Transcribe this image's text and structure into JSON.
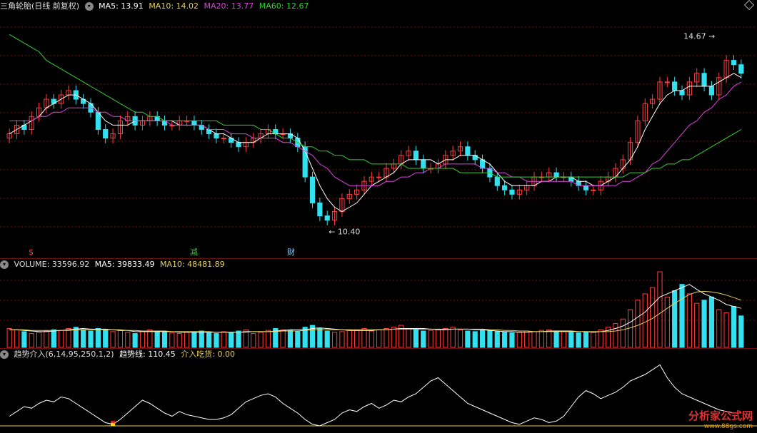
{
  "main_header": {
    "title": "三角轮胎(日线 前复权)",
    "ma5": "MA5: 13.91",
    "ma10": "MA10: 14.02",
    "ma20": "MA20: 13.77",
    "ma60": "MA60: 12.67"
  },
  "annotations": {
    "high_label": "14.67",
    "low_label": "10.40",
    "mark_s": "$",
    "mark_jian": "减",
    "mark_cai": "财"
  },
  "volume_header": {
    "volume": "VOLUME: 33596.92",
    "ma5": "MA5: 39833.49",
    "ma10": "MA10: 48481.89"
  },
  "indicator_header": {
    "name": "趋势介入(6,14,95,250,1,2)",
    "trend": "趋势线: 110.45",
    "entry": "介入吃货: 0.00"
  },
  "watermark": {
    "text": "分析家公式网",
    "url": "www.88gs.com"
  },
  "colors": {
    "up": "#ff3d3d",
    "down": "#33e0f0",
    "ma5": "#ffffff",
    "ma10": "#e6d060",
    "ma20": "#e040e0",
    "ma60": "#30d030",
    "grid": "#7a1010"
  },
  "chart_data": [
    {
      "type": "candlestick",
      "title": "三角轮胎(日线 前复权)",
      "ylim": [
        10.0,
        15.4
      ],
      "annotations": [
        {
          "label": "14.67",
          "kind": "high"
        },
        {
          "label": "10.40",
          "kind": "low"
        }
      ],
      "close": [
        12.6,
        12.8,
        12.7,
        13.0,
        13.2,
        13.4,
        13.3,
        13.5,
        13.6,
        13.4,
        13.3,
        13.1,
        12.7,
        12.5,
        12.6,
        12.9,
        13.0,
        12.8,
        12.9,
        13.0,
        12.9,
        12.8,
        12.8,
        12.9,
        12.9,
        12.8,
        12.7,
        12.6,
        12.5,
        12.5,
        12.4,
        12.3,
        12.4,
        12.5,
        12.6,
        12.7,
        12.6,
        12.6,
        12.5,
        12.3,
        11.6,
        11.0,
        10.7,
        10.6,
        10.8,
        11.1,
        11.2,
        11.3,
        11.5,
        11.6,
        11.6,
        11.8,
        11.9,
        12.1,
        12.2,
        12.0,
        11.8,
        11.8,
        11.9,
        12.1,
        12.2,
        12.3,
        12.1,
        12.0,
        11.8,
        11.6,
        11.4,
        11.3,
        11.2,
        11.3,
        11.4,
        11.6,
        11.6,
        11.7,
        11.6,
        11.6,
        11.5,
        11.4,
        11.3,
        11.3,
        11.5,
        11.6,
        11.8,
        12.0,
        12.4,
        12.9,
        13.3,
        13.4,
        13.8,
        13.8,
        13.6,
        13.5,
        13.8,
        14.0,
        13.7,
        13.5,
        13.9,
        14.3,
        14.2,
        14.0
      ],
      "ma5": [
        12.6,
        12.7,
        12.8,
        12.9,
        13.0,
        13.2,
        13.3,
        13.4,
        13.5,
        13.5,
        13.4,
        13.3,
        13.1,
        12.9,
        12.8,
        12.8,
        12.8,
        12.9,
        12.9,
        12.9,
        12.9,
        12.9,
        12.9,
        12.8,
        12.8,
        12.8,
        12.8,
        12.7,
        12.6,
        12.6,
        12.5,
        12.4,
        12.4,
        12.4,
        12.5,
        12.6,
        12.6,
        12.6,
        12.6,
        12.5,
        12.2,
        11.8,
        11.4,
        11.1,
        10.9,
        10.8,
        10.9,
        11.0,
        11.2,
        11.4,
        11.5,
        11.6,
        11.7,
        11.9,
        12.0,
        12.0,
        12.0,
        12.0,
        11.9,
        12.0,
        12.0,
        12.1,
        12.1,
        12.1,
        12.0,
        11.9,
        11.7,
        11.5,
        11.4,
        11.4,
        11.4,
        11.4,
        11.5,
        11.5,
        11.6,
        11.6,
        11.6,
        11.5,
        11.5,
        11.4,
        11.4,
        11.5,
        11.6,
        11.8,
        12.0,
        12.3,
        12.7,
        13.0,
        13.3,
        13.5,
        13.6,
        13.6,
        13.7,
        13.7,
        13.7,
        13.7,
        13.8,
        13.9,
        14.0,
        13.9
      ],
      "ma20": [
        12.9,
        12.9,
        12.9,
        12.9,
        13.0,
        13.0,
        13.1,
        13.1,
        13.2,
        13.2,
        13.2,
        13.2,
        13.1,
        13.1,
        13.0,
        13.0,
        12.9,
        12.9,
        12.9,
        12.9,
        12.9,
        12.9,
        12.8,
        12.8,
        12.8,
        12.8,
        12.8,
        12.7,
        12.7,
        12.7,
        12.6,
        12.6,
        12.6,
        12.5,
        12.5,
        12.5,
        12.5,
        12.4,
        12.4,
        12.3,
        12.2,
        12.1,
        11.9,
        11.8,
        11.6,
        11.5,
        11.4,
        11.4,
        11.4,
        11.4,
        11.4,
        11.5,
        11.5,
        11.6,
        11.6,
        11.7,
        11.7,
        11.8,
        11.8,
        11.9,
        11.9,
        11.9,
        11.9,
        11.9,
        11.8,
        11.8,
        11.7,
        11.7,
        11.6,
        11.6,
        11.5,
        11.5,
        11.5,
        11.5,
        11.5,
        11.5,
        11.5,
        11.4,
        11.4,
        11.4,
        11.4,
        11.4,
        11.4,
        11.5,
        11.5,
        11.6,
        11.7,
        11.9,
        12.0,
        12.2,
        12.4,
        12.6,
        12.8,
        12.9,
        13.1,
        13.2,
        13.4,
        13.5,
        13.7,
        13.8
      ],
      "ma60": [
        14.9,
        14.8,
        14.7,
        14.6,
        14.5,
        14.3,
        14.2,
        14.1,
        14.0,
        13.9,
        13.8,
        13.7,
        13.6,
        13.5,
        13.4,
        13.3,
        13.2,
        13.1,
        13.1,
        13.0,
        13.0,
        12.9,
        12.9,
        12.9,
        12.9,
        12.9,
        12.9,
        12.9,
        12.9,
        12.8,
        12.8,
        12.8,
        12.8,
        12.8,
        12.7,
        12.7,
        12.6,
        12.5,
        12.5,
        12.4,
        12.3,
        12.3,
        12.2,
        12.2,
        12.1,
        12.1,
        12.0,
        12.0,
        12.0,
        11.9,
        11.9,
        11.9,
        11.9,
        11.9,
        11.8,
        11.8,
        11.8,
        11.8,
        11.8,
        11.8,
        11.8,
        11.7,
        11.7,
        11.7,
        11.7,
        11.7,
        11.6,
        11.6,
        11.6,
        11.6,
        11.6,
        11.6,
        11.6,
        11.6,
        11.6,
        11.6,
        11.6,
        11.6,
        11.6,
        11.6,
        11.6,
        11.6,
        11.6,
        11.6,
        11.7,
        11.7,
        11.7,
        11.8,
        11.8,
        11.9,
        11.9,
        12.0,
        12.0,
        12.1,
        12.2,
        12.3,
        12.4,
        12.5,
        12.6,
        12.7
      ]
    },
    {
      "type": "bar",
      "title": "VOLUME",
      "ylim": [
        0,
        120000
      ],
      "values": [
        30,
        28,
        25,
        22,
        24,
        26,
        28,
        27,
        30,
        32,
        28,
        26,
        30,
        28,
        25,
        27,
        24,
        22,
        26,
        28,
        25,
        24,
        23,
        22,
        24,
        25,
        26,
        23,
        22,
        25,
        24,
        26,
        28,
        22,
        24,
        27,
        30,
        28,
        27,
        25,
        32,
        35,
        30,
        26,
        24,
        25,
        28,
        27,
        30,
        26,
        28,
        30,
        32,
        35,
        30,
        28,
        26,
        27,
        28,
        30,
        32,
        28,
        26,
        25,
        27,
        26,
        25,
        24,
        23,
        24,
        26,
        25,
        27,
        28,
        26,
        25,
        24,
        23,
        25,
        24,
        28,
        32,
        38,
        45,
        60,
        75,
        85,
        95,
        120,
        80,
        90,
        100,
        85,
        70,
        75,
        80,
        60,
        55,
        65,
        50
      ],
      "ma5": [
        28,
        28,
        27,
        26,
        25,
        25,
        26,
        27,
        28,
        29,
        30,
        29,
        29,
        29,
        28,
        27,
        27,
        25,
        25,
        25,
        25,
        25,
        25,
        24,
        24,
        24,
        24,
        24,
        24,
        24,
        24,
        24,
        25,
        25,
        25,
        25,
        26,
        27,
        28,
        28,
        28,
        30,
        31,
        30,
        29,
        28,
        27,
        27,
        27,
        27,
        28,
        28,
        29,
        30,
        30,
        30,
        30,
        29,
        28,
        28,
        29,
        29,
        29,
        28,
        28,
        27,
        26,
        25,
        25,
        24,
        24,
        25,
        25,
        26,
        26,
        26,
        26,
        25,
        25,
        24,
        25,
        27,
        30,
        34,
        40,
        48,
        56,
        68,
        80,
        85,
        90,
        95,
        100,
        92,
        85,
        80,
        75,
        68,
        65,
        62
      ],
      "ma10": [
        28,
        28,
        28,
        27,
        27,
        27,
        27,
        27,
        27,
        28,
        28,
        28,
        28,
        28,
        28,
        28,
        27,
        27,
        26,
        26,
        26,
        26,
        25,
        25,
        25,
        25,
        25,
        25,
        24,
        24,
        24,
        24,
        24,
        25,
        25,
        25,
        25,
        26,
        26,
        26,
        27,
        28,
        28,
        28,
        28,
        28,
        28,
        28,
        28,
        28,
        28,
        28,
        29,
        29,
        29,
        29,
        29,
        29,
        29,
        29,
        29,
        29,
        29,
        29,
        29,
        28,
        28,
        27,
        27,
        26,
        26,
        25,
        25,
        25,
        25,
        25,
        25,
        25,
        25,
        25,
        25,
        25,
        26,
        28,
        31,
        35,
        40,
        46,
        54,
        62,
        70,
        77,
        84,
        88,
        89,
        88,
        86,
        83,
        79,
        75
      ]
    },
    {
      "type": "line",
      "title": "趋势介入(6,14,95,250,1,2)",
      "ylim": [
        0,
        200
      ],
      "trend": [
        30,
        45,
        60,
        55,
        70,
        80,
        75,
        90,
        85,
        70,
        55,
        40,
        25,
        10,
        5,
        20,
        40,
        60,
        80,
        70,
        55,
        40,
        30,
        45,
        35,
        30,
        25,
        20,
        20,
        25,
        35,
        55,
        75,
        85,
        95,
        100,
        90,
        70,
        55,
        40,
        20,
        5,
        0,
        10,
        20,
        40,
        50,
        45,
        60,
        70,
        55,
        65,
        80,
        75,
        90,
        100,
        120,
        140,
        150,
        130,
        110,
        90,
        70,
        60,
        50,
        40,
        30,
        20,
        10,
        5,
        15,
        25,
        20,
        10,
        15,
        30,
        60,
        90,
        110,
        100,
        85,
        95,
        105,
        120,
        140,
        150,
        160,
        175,
        190,
        150,
        120,
        100,
        90,
        80,
        70,
        60,
        50,
        45,
        40,
        40
      ],
      "entry": [
        0,
        0,
        0,
        0,
        0,
        0,
        0,
        0,
        0,
        0,
        0,
        0,
        0,
        0,
        15,
        0,
        0,
        0,
        0,
        0,
        0,
        0,
        0,
        0,
        0,
        0,
        0,
        0,
        0,
        0,
        0,
        0,
        0,
        0,
        0,
        0,
        0,
        0,
        0,
        0,
        0,
        0,
        0,
        0,
        0,
        0,
        0,
        0,
        0,
        0,
        0,
        0,
        0,
        0,
        0,
        0,
        0,
        0,
        0,
        0,
        0,
        0,
        0,
        0,
        0,
        0,
        0,
        0,
        0,
        0,
        0,
        0,
        0,
        0,
        0,
        0,
        0,
        0,
        0,
        0,
        0,
        0,
        0,
        0,
        0,
        0,
        0,
        0,
        0,
        0,
        0,
        0,
        0,
        0,
        0,
        0,
        0,
        0,
        0,
        0
      ]
    }
  ]
}
